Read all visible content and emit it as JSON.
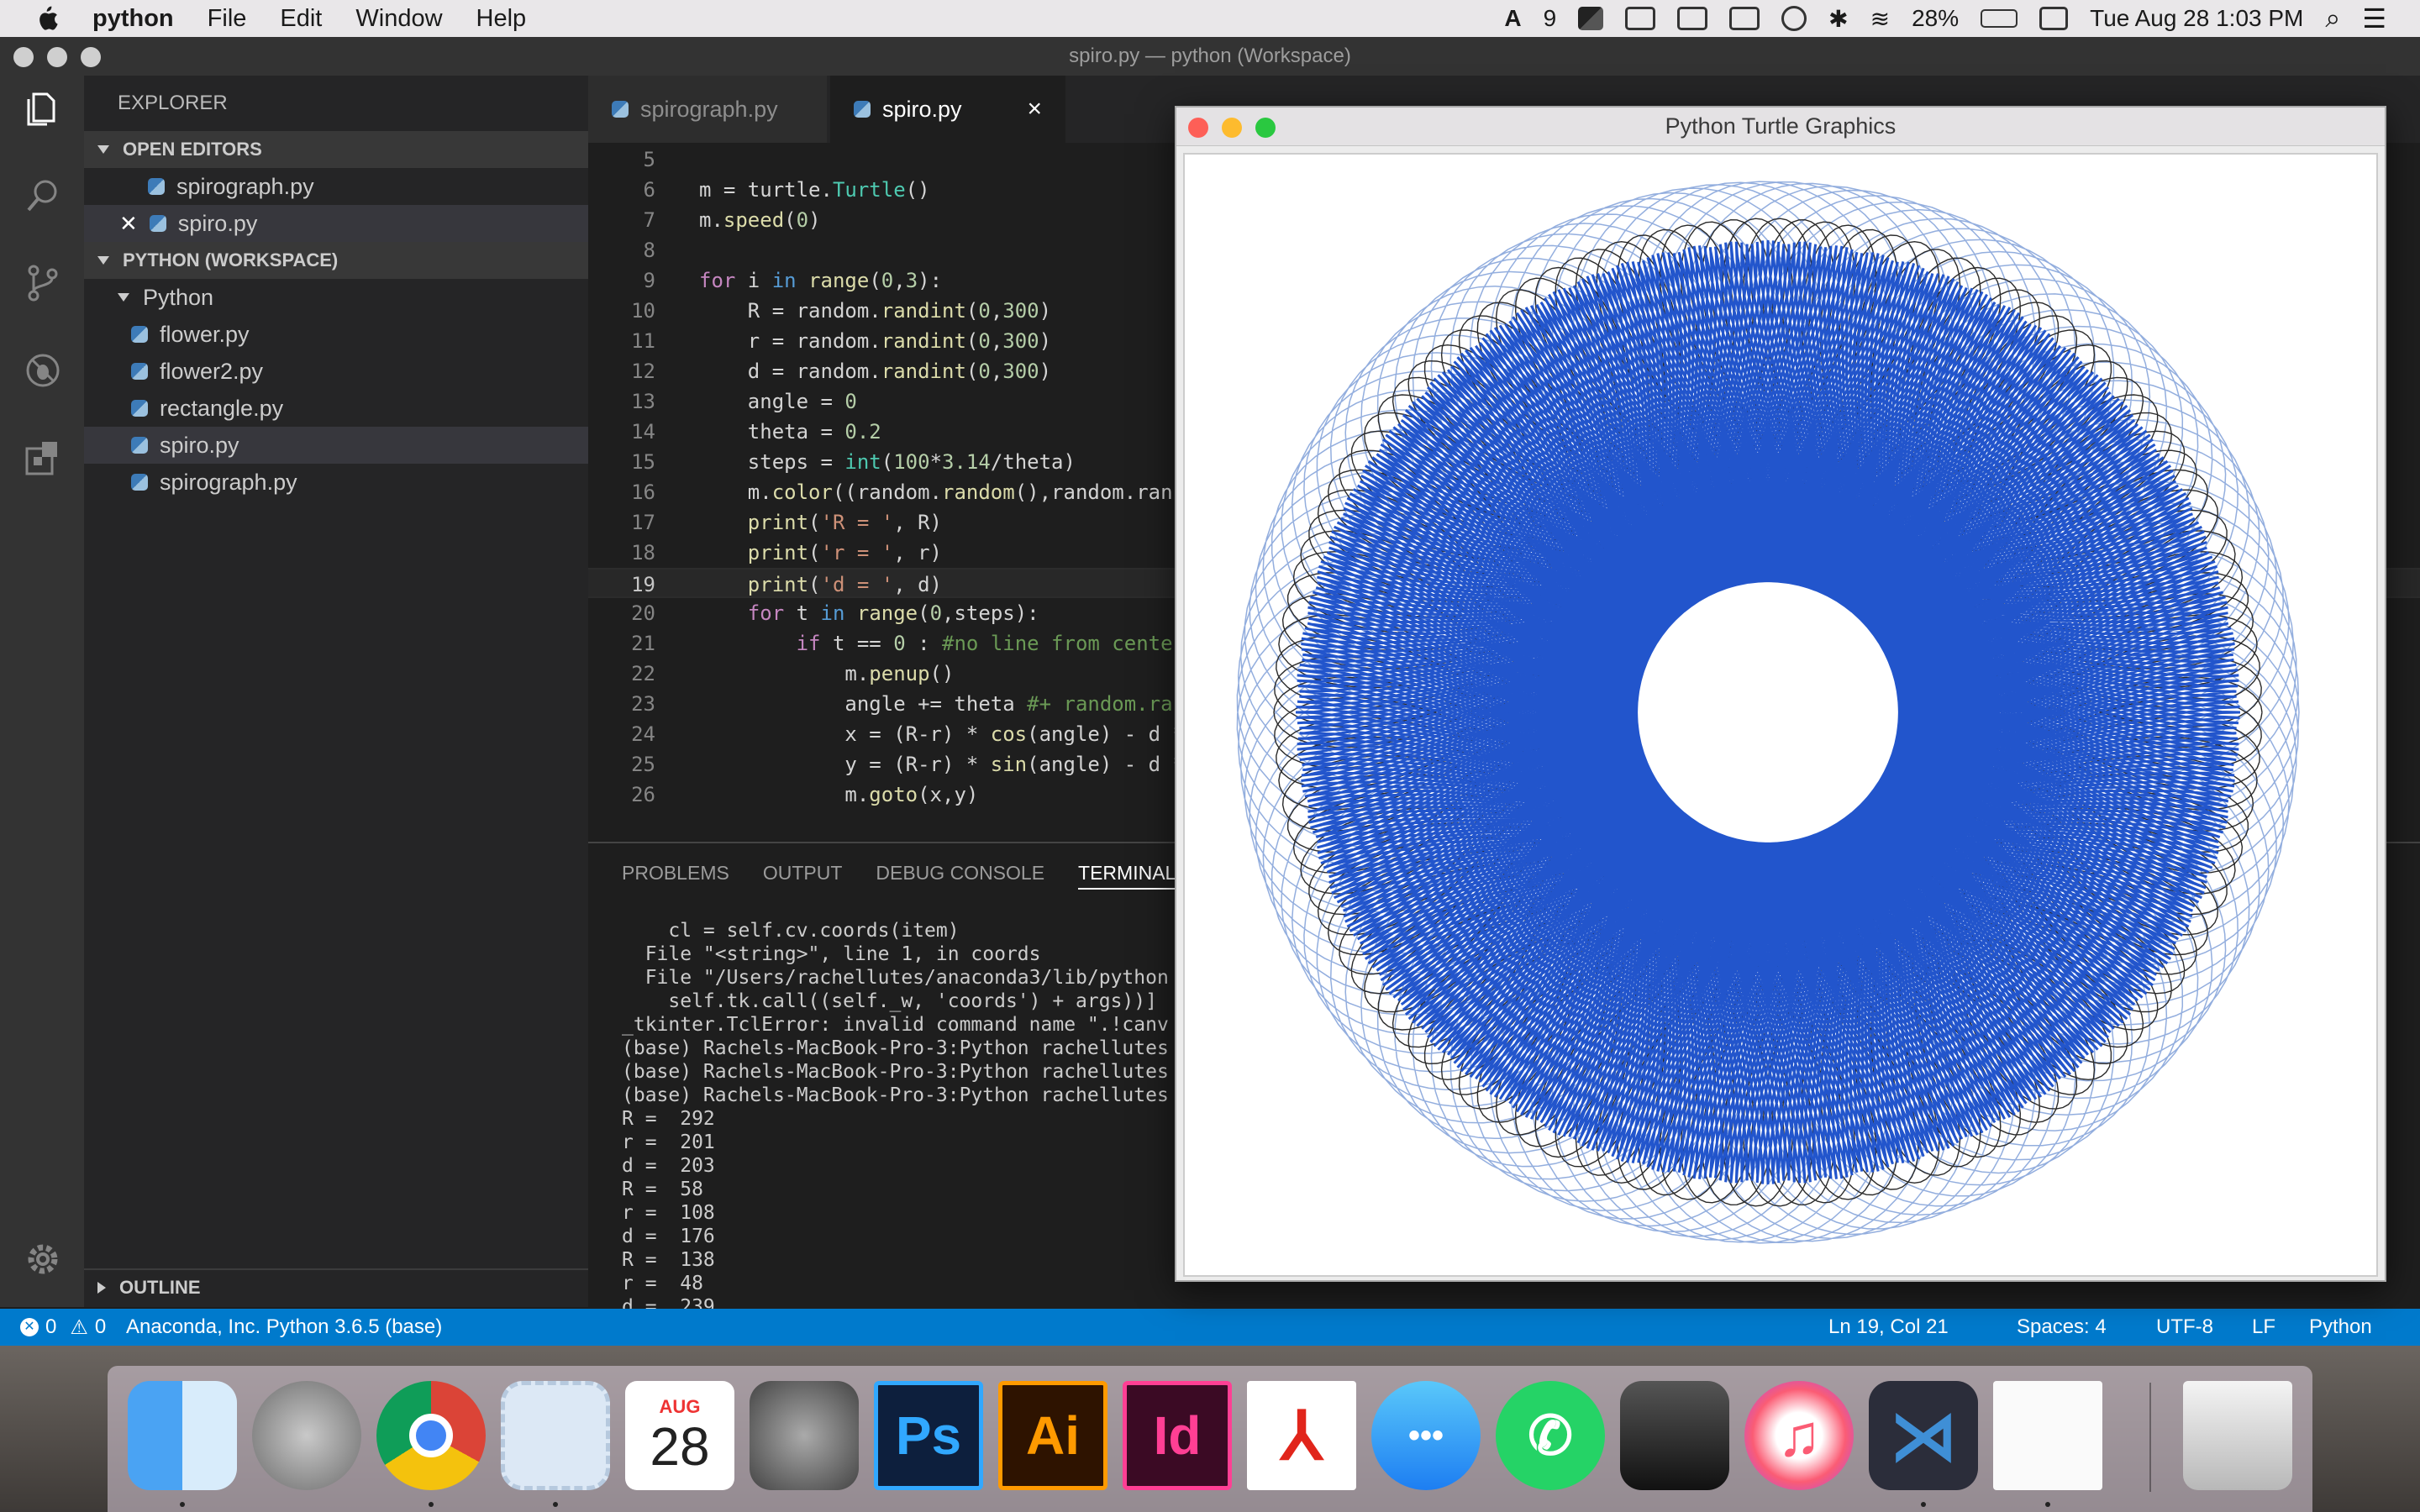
{
  "menubar": {
    "app": "python",
    "items": [
      "File",
      "Edit",
      "Window",
      "Help"
    ],
    "status": {
      "adobe_badge": "9",
      "battery": "28%",
      "datetime": "Tue Aug 28  1:03 PM"
    }
  },
  "window": {
    "title": "spiro.py — python (Workspace)"
  },
  "sidebar": {
    "header": "EXPLORER",
    "open_editors_label": "OPEN EDITORS",
    "open_editors": [
      "spirograph.py",
      "spiro.py"
    ],
    "workspace_label": "PYTHON (WORKSPACE)",
    "folder": "Python",
    "files": [
      "flower.py",
      "flower2.py",
      "rectangle.py",
      "spiro.py",
      "spirograph.py"
    ],
    "outline_label": "OUTLINE"
  },
  "tabs": [
    {
      "label": "spirograph.py"
    },
    {
      "label": "spiro.py",
      "close": "×"
    }
  ],
  "editor": {
    "line_numbers": [
      "5",
      "6",
      "7",
      "8",
      "9",
      "10",
      "11",
      "12",
      "13",
      "14",
      "15",
      "16",
      "17",
      "18",
      "19",
      "20",
      "21",
      "22",
      "23",
      "24",
      "25",
      "26"
    ],
    "current_line": "19"
  },
  "panel": {
    "tabs": [
      "PROBLEMS",
      "OUTPUT",
      "DEBUG CONSOLE",
      "TERMINAL"
    ],
    "terminal_lines": [
      "    cl = self.cv.coords(item)",
      "  File \"<string>\", line 1, in coords",
      "  File \"/Users/rachellutes/anaconda3/lib/python",
      "    self.tk.call((self._w, 'coords') + args))]",
      "_tkinter.TclError: invalid command name \".!canv",
      "(base) Rachels-MacBook-Pro-3:Python rachellutes",
      "(base) Rachels-MacBook-Pro-3:Python rachellutes",
      "(base) Rachels-MacBook-Pro-3:Python rachellutes",
      "R =  292",
      "r =  201",
      "d =  203",
      "R =  58",
      "r =  108",
      "d =  176",
      "R =  138",
      "r =  48",
      "d =  239"
    ]
  },
  "statusbar": {
    "errors": "0",
    "warnings": "0",
    "interpreter": "Anaconda, Inc. Python 3.6.5 (base)",
    "position": "Ln 19, Col 21",
    "spaces": "Spaces: 4",
    "encoding": "UTF-8",
    "eol": "LF",
    "language": "Python"
  },
  "turtle_window": {
    "title": "Python Turtle Graphics"
  },
  "dock": {
    "calendar_month": "AUG",
    "calendar_day": "28",
    "ps": "Ps",
    "ai": "Ai",
    "id": "Id"
  },
  "colors": {
    "statusbar": "#007acc",
    "spiro_blue": "#2255cc",
    "spiro_light": "#93aede",
    "spiro_dark": "#2a2a2a"
  }
}
